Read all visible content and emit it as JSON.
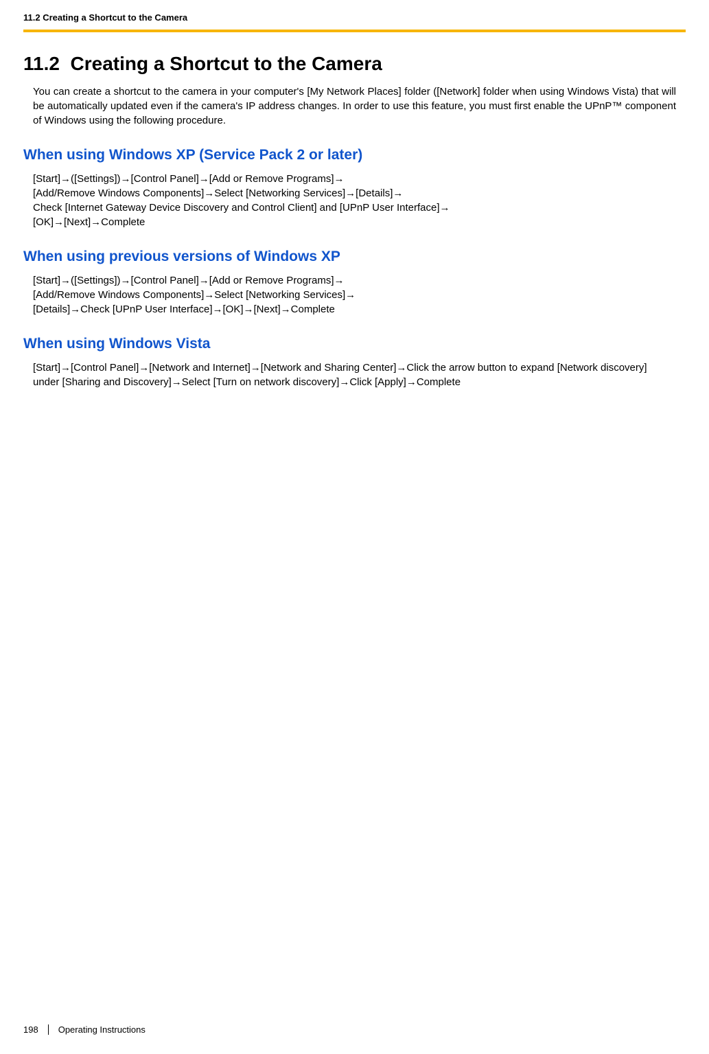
{
  "header": {
    "breadcrumb": "11.2 Creating a Shortcut to the Camera"
  },
  "section": {
    "number": "11.2",
    "title": "Creating a Shortcut to the Camera",
    "intro": "You can create a shortcut to the camera in your computer's [My Network Places] folder ([Network] folder when using Windows Vista) that will be automatically updated even if the camera's IP address changes. In order to use this feature, you must first enable the UPnP™ component of Windows using the following procedure."
  },
  "subsections": [
    {
      "heading": "When using Windows XP (Service Pack 2 or later)",
      "body": "[Start]→([Settings])→[Control Panel]→[Add or Remove Programs]→\n[Add/Remove Windows Components]→Select [Networking Services]→[Details]→\nCheck [Internet Gateway Device Discovery and Control Client] and [UPnP User Interface]→\n[OK]→[Next]→Complete"
    },
    {
      "heading": "When using previous versions of Windows XP",
      "body": "[Start]→([Settings])→[Control Panel]→[Add or Remove Programs]→\n[Add/Remove Windows Components]→Select [Networking Services]→\n[Details]→Check [UPnP User Interface]→[OK]→[Next]→Complete"
    },
    {
      "heading": "When using Windows Vista",
      "body": "[Start]→[Control Panel]→[Network and Internet]→[Network and Sharing Center]→Click the arrow button to expand [Network discovery] under [Sharing and Discovery]→Select [Turn on network discovery]→Click [Apply]→Complete"
    }
  ],
  "footer": {
    "page_number": "198",
    "doc_title": "Operating Instructions"
  }
}
